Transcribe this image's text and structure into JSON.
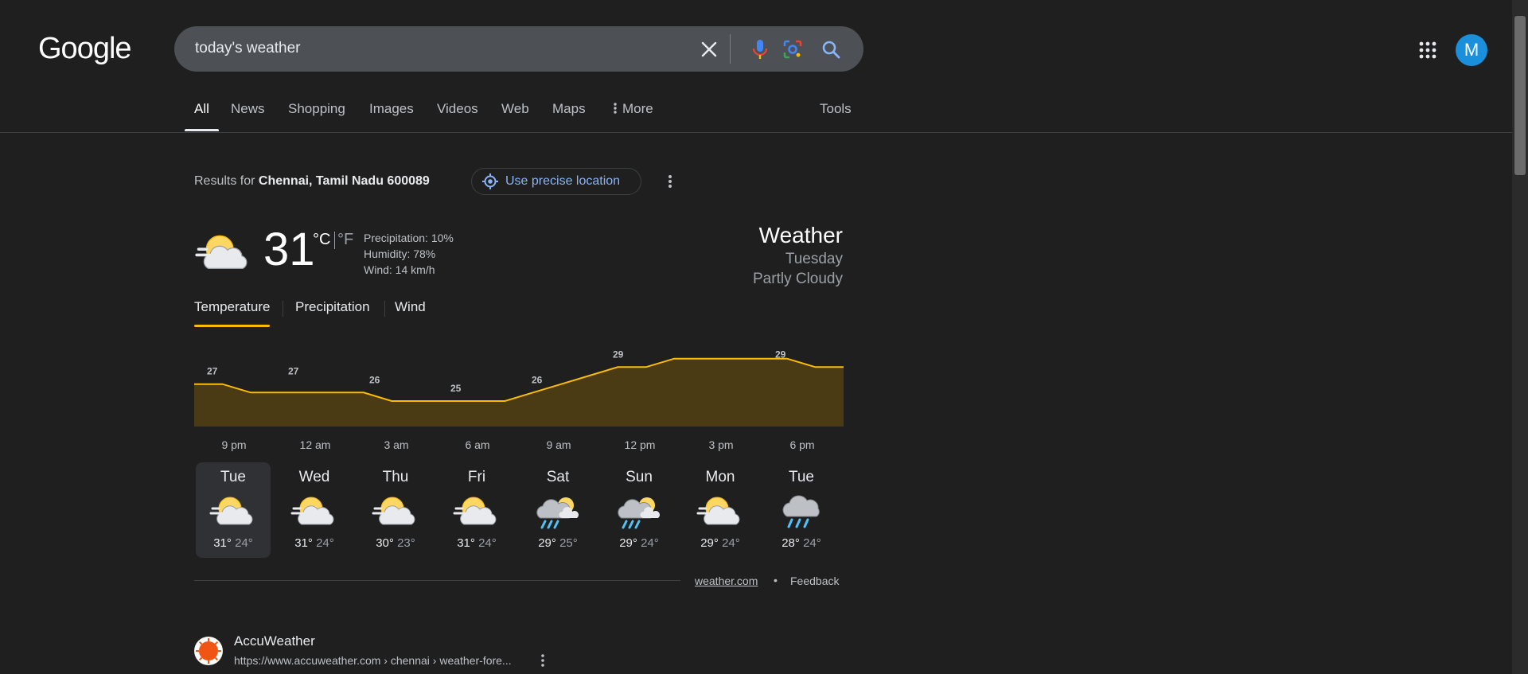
{
  "logo": "Google",
  "search": {
    "query": "today's weather",
    "icons": [
      "close-icon",
      "mic-icon",
      "lens-icon",
      "search-icon"
    ]
  },
  "header": {
    "apps_icon": "apps-grid-icon",
    "avatar_letter": "M",
    "avatar_color": "#1a8fdc"
  },
  "tabs": [
    {
      "label": "All",
      "active": true
    },
    {
      "label": "News"
    },
    {
      "label": "Shopping"
    },
    {
      "label": "Images"
    },
    {
      "label": "Videos"
    },
    {
      "label": "Web"
    },
    {
      "label": "Maps"
    },
    {
      "label": "More"
    }
  ],
  "tools_label": "Tools",
  "location": {
    "prefix": "Results for",
    "place": "Chennai, Tamil Nadu 600089",
    "precise_label": "Use precise location"
  },
  "current": {
    "temp": "31",
    "unit_c": "°C",
    "unit_f": "°F",
    "precipitation": "Precipitation: 10%",
    "humidity": "Humidity: 78%",
    "wind": "Wind: 14 km/h",
    "icon": "partly-cloudy-icon"
  },
  "summary": {
    "title": "Weather",
    "day": "Tuesday",
    "condition": "Partly Cloudy"
  },
  "subtabs": [
    {
      "label": "Temperature",
      "active": true
    },
    {
      "label": "Precipitation"
    },
    {
      "label": "Wind"
    }
  ],
  "chart_data": {
    "type": "area",
    "x": [
      "9 pm",
      "12 am",
      "3 am",
      "6 am",
      "9 am",
      "12 pm",
      "3 pm",
      "6 pm"
    ],
    "values": [
      27,
      27,
      26,
      25,
      26,
      29,
      30,
      29
    ],
    "series": [
      {
        "hourly_values": [
          27,
          27,
          26,
          26,
          26,
          26,
          26,
          25,
          25,
          25,
          25,
          25,
          26,
          27,
          28,
          29,
          29,
          30,
          30,
          30,
          30,
          30,
          29,
          29
        ]
      }
    ],
    "line_color": "#fbbc04",
    "fill_color": "#4a3b14"
  },
  "forecast": [
    {
      "day": "Tue",
      "high": "31°",
      "low": "24°",
      "icon": "partly-cloudy-icon",
      "active": true
    },
    {
      "day": "Wed",
      "high": "31°",
      "low": "24°",
      "icon": "partly-cloudy-icon"
    },
    {
      "day": "Thu",
      "high": "30°",
      "low": "23°",
      "icon": "partly-cloudy-icon"
    },
    {
      "day": "Fri",
      "high": "31°",
      "low": "24°",
      "icon": "partly-cloudy-icon"
    },
    {
      "day": "Sat",
      "high": "29°",
      "low": "25°",
      "icon": "scattered-thunderstorms-icon"
    },
    {
      "day": "Sun",
      "high": "29°",
      "low": "24°",
      "icon": "scattered-thunderstorms-icon"
    },
    {
      "day": "Mon",
      "high": "29°",
      "low": "24°",
      "icon": "partly-cloudy-icon"
    },
    {
      "day": "Tue",
      "high": "28°",
      "low": "24°",
      "icon": "rain-icon"
    }
  ],
  "footer": {
    "source": "weather.com",
    "separator": "•",
    "feedback": "Feedback"
  },
  "result": {
    "site": "AccuWeather",
    "url": "https://www.accuweather.com › chennai › weather-fore...",
    "favicon_color": "#f05514"
  }
}
